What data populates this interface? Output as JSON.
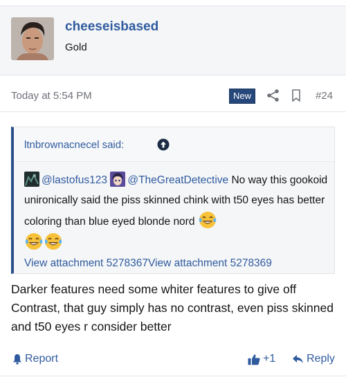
{
  "post": {
    "author": "cheeseisbased",
    "user_title": "Gold",
    "timestamp": "Today at 5:54 PM",
    "badge": "New",
    "post_number": "#24"
  },
  "quote": {
    "author_said": "ltnbrownacnecel said:",
    "mention1": "@lastofus123",
    "mention2": "@TheGreatDetective",
    "text": " No way this gookoid unironically said the piss skinned chink with t50 eyes has better coloring than blue eyed blonde nord ",
    "attachment1": "View attachment 5278367",
    "attachment2": "View attachment 5278369"
  },
  "reply": {
    "text": "Darker features need some whiter features to give off Contrast, that guy simply has no contrast, even piss skinned and t50 eyes r consider better"
  },
  "actions": {
    "report_label": "Report",
    "like_count": "+1",
    "reply_label": "Reply"
  },
  "colors": {
    "link": "#2f5b9e",
    "badge_bg": "#26477a",
    "quote_border": "#2a4f8a",
    "header_bg": "#f5f6f8"
  },
  "icons": {
    "share": "share-icon",
    "bookmark": "bookmark-icon",
    "quote_jump": "arrow-up-circle-icon",
    "report": "bell-icon",
    "like": "thumbs-up-icon",
    "reply": "reply-arrow-icon",
    "emoji": "tears-of-joy-emoji"
  }
}
